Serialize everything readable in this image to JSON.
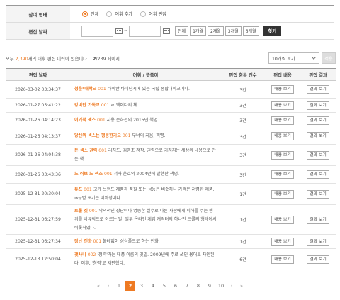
{
  "filter": {
    "participation_label": "참여 형태",
    "radios": [
      {
        "label": "전체",
        "checked": true
      },
      {
        "label": "어휘 추가",
        "checked": false
      },
      {
        "label": "어휘 편집",
        "checked": false
      }
    ],
    "date_label": "편집 날짜",
    "date_start_value": "",
    "date_end_value": "",
    "tilde": "~",
    "periods": [
      "전체",
      "1개월",
      "2개월",
      "3개월",
      "6개월"
    ],
    "search_label": "찾기"
  },
  "summary": {
    "prefix": "모두 ",
    "count": "2,390",
    "suffix": "개의 어휘 편집 이력이 있습니다.",
    "page_current": "2",
    "page_total": "/239 페이지"
  },
  "page_size": {
    "selected": "10개씩 보기"
  },
  "apply_label": "적용",
  "table": {
    "headers": [
      "편집 날짜",
      "어휘 / 뜻풀이",
      "편집 항목 건수",
      "편집 내용",
      "편집 결과"
    ],
    "rows": [
      {
        "date": "2026-03-02 03:34:37",
        "word": "청운*대학교",
        "num": "001",
        "def": "타이완 타이난시에 있는 국립 종합대학교이다.",
        "count": "3건",
        "content_btn": "내용 보기",
        "result_btn": "결과 보기"
      },
      {
        "date": "2026-01-27 05:41:22",
        "word": "강비안 가독교",
        "num": "001",
        "def": "ㄹ 멕이다의 체.",
        "count": "3건",
        "content_btn": "내용 보기",
        "result_btn": "결과 보기"
      },
      {
        "date": "2026-01-26 04:14:23",
        "word": "이기적 섹스",
        "num": "001",
        "def": "지용 은하선의 2015년 책명.",
        "count": "3건",
        "content_btn": "내용 보기",
        "result_btn": "결과 보기"
      },
      {
        "date": "2026-01-26 04:13:37",
        "word": "당신의 섹스는 평등한가요",
        "num": "001",
        "def": "부너의 지음, 책명.",
        "count": "3건",
        "content_btn": "내용 보기",
        "result_btn": "결과 보기"
      },
      {
        "date": "2026-01-26 04:04:38",
        "word": "돈 섹스 권력",
        "num": "001",
        "def": "리처드, 김명조 저작. 권력으로 가져지는 세상의 내용으로 만든 책.",
        "count": "3건",
        "content_btn": "내용 보기",
        "result_btn": "결과 보기"
      },
      {
        "date": "2026-01-26 03:43:36",
        "word": "노 러브 노 섹스",
        "num": "001",
        "def": "저자 윤효의 2004년에 발행한 책명.",
        "count": "3건",
        "content_btn": "내용 보기",
        "result_btn": "결과 보기"
      },
      {
        "date": "2025-12-31 20:30:04",
        "word": "듀프",
        "num": "001",
        "def": "고가 브랜드 제품과 품질 또는 성능은 비슷하나 가격은 저렴한 제품. ⇒규범 표기는 미확정이다.",
        "count": "1건",
        "content_btn": "내용 보기",
        "result_btn": "결과 보기"
      },
      {
        "date": "2025-12-31 06:27:59",
        "word": "트롤 짓",
        "num": "001",
        "def": "악의적인 장난이나 엉뚱한 실수로 다른 사람에게 피해를 주는 행위를 비유적으로 이르는 말. 일부 온라인 게임 캐릭터의 하나인 트롤의 형태에서 비롯하였다.",
        "count": "1건",
        "content_btn": "내용 보기",
        "result_btn": "결과 보기"
      },
      {
        "date": "2025-12-31 06:27:34",
        "word": "장난 전화",
        "num": "001",
        "def": "불테없이 성심풀으로 하는 전화.",
        "count": "1건",
        "content_btn": "내용 보기",
        "result_btn": "결과 보기"
      },
      {
        "date": "2025-12-13 12:50:04",
        "word": "갯사나",
        "num": "002",
        "def": "'청력'라는 태풍 이름의 옛말. 2009년에 주로 쓰인 용어로 자인된다. 이후, '청력'로 재편했다.",
        "count": "6건",
        "content_btn": "내용 보기",
        "result_btn": "결과 보기"
      }
    ]
  },
  "pagination": {
    "first": "«",
    "prev": "‹",
    "pages": [
      "1",
      "2",
      "3",
      "4",
      "5",
      "6",
      "7",
      "8",
      "9",
      "10"
    ],
    "current": "2",
    "next": "›",
    "last": "»"
  },
  "colors": {
    "accent": "#ee7a23",
    "dark_button": "#333333"
  }
}
